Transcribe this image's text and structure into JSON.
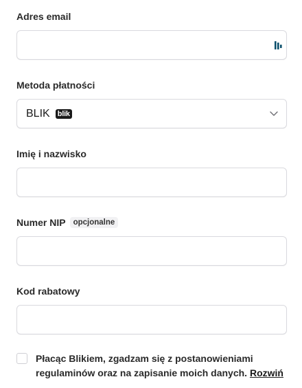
{
  "form": {
    "email": {
      "label": "Adres email",
      "value": "",
      "placeholder": ""
    },
    "payment_method": {
      "label": "Metoda płatności",
      "selected": "BLIK",
      "logo_text": "blik"
    },
    "full_name": {
      "label": "Imię i nazwisko",
      "value": "",
      "placeholder": ""
    },
    "nip": {
      "label": "Numer NIP",
      "optional_badge": "opcjonalne",
      "value": "",
      "placeholder": ""
    },
    "discount_code": {
      "label": "Kod rabatowy",
      "value": "",
      "placeholder": ""
    }
  },
  "consent": {
    "checked": false,
    "text": "Płacąc Blikiem, zgadzam się z postanowieniami regulaminów oraz na zapisanie moich danych.",
    "link_label": "Rozwiń"
  },
  "icons": {
    "autofill": "password-manager-icon",
    "select": "chevron-down-icon"
  },
  "colors": {
    "border": "#d9d9de",
    "text": "#1f1f1f",
    "badge_bg": "#f1f1f3",
    "blik_logo_bg": "#1a1a1a",
    "autofill_icon": "#0b4f6c"
  }
}
